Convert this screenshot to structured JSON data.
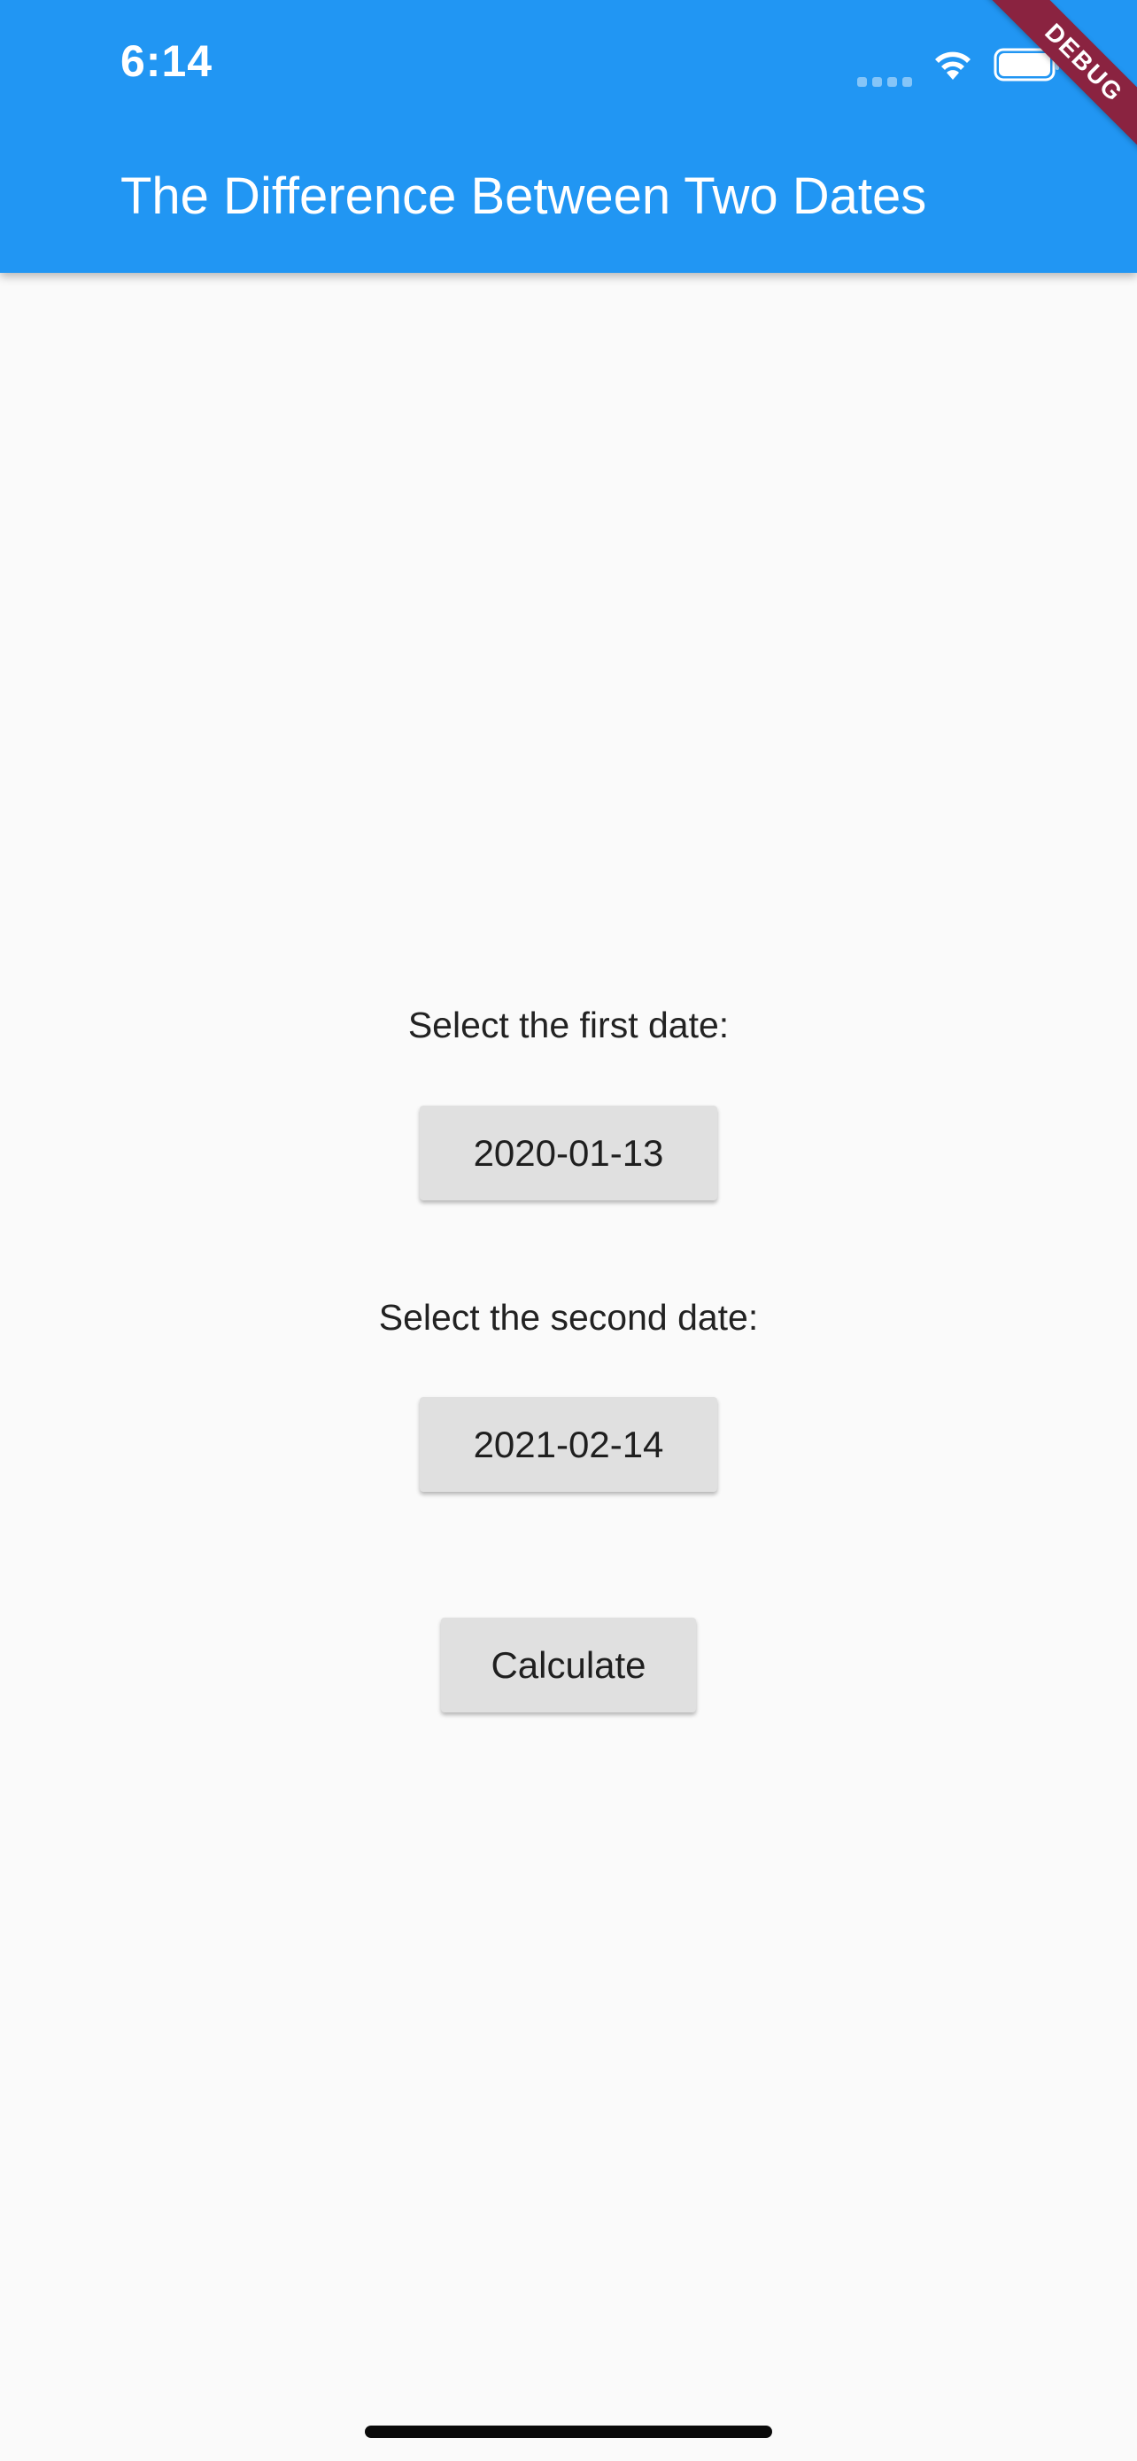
{
  "status_bar": {
    "time": "6:14",
    "icons": [
      "signal-icon",
      "wifi-icon",
      "battery-icon"
    ]
  },
  "app_bar": {
    "title": "The Difference Between Two Dates",
    "background_color": "#2196f3"
  },
  "debug_banner": {
    "label": "DEBUG",
    "color": "#8a2340"
  },
  "form": {
    "first_date_label": "Select the first date:",
    "first_date_value": "2020-01-13",
    "second_date_label": "Select the second date:",
    "second_date_value": "2021-02-14",
    "calculate_label": "Calculate"
  }
}
